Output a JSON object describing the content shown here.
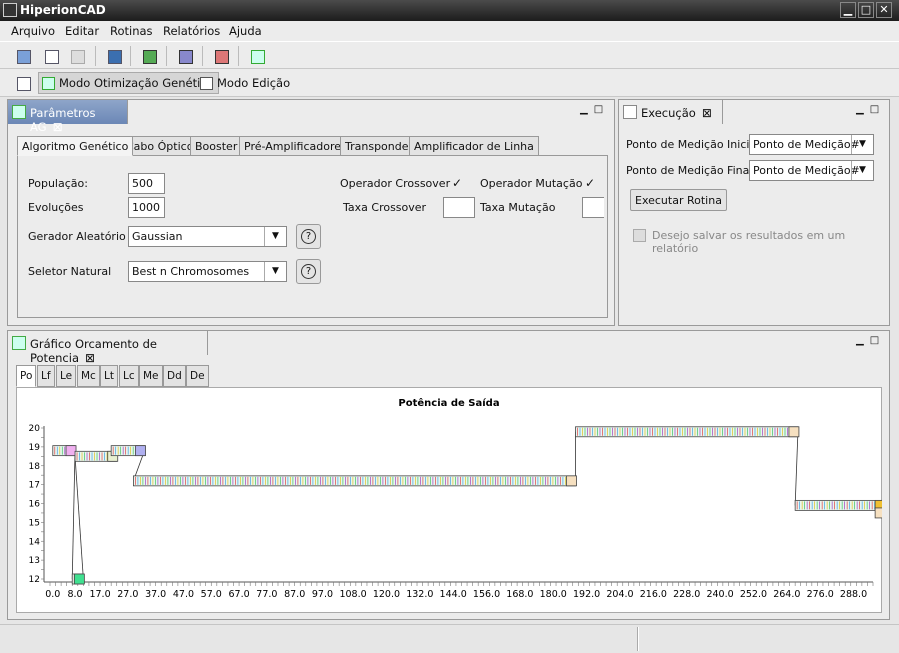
{
  "window": {
    "title": "HiperionCAD",
    "min": "▁",
    "max": "□",
    "close": "✕"
  },
  "menu": [
    "Arquivo",
    "Editar",
    "Rotinas",
    "Relatórios",
    "Ajuda"
  ],
  "perspectives": [
    "Modo Otimização Genética",
    "Modo Edição"
  ],
  "ag_view": {
    "tab_title": "Parâmetros AG",
    "tabs": [
      "Algoritmo Genético",
      "Cabo Óptico",
      "Booster",
      "Pré-Amplificadores",
      "Transponder",
      "Amplificador de Linha"
    ],
    "populacao_label": "População:",
    "populacao": "500",
    "evolucoes_label": "Evoluções",
    "evolucoes": "1000",
    "gerador_label": "Gerador Aleatório",
    "gerador": "Gaussian",
    "seletor_label": "Seletor Natural",
    "seletor": "Best n Chromosomes",
    "op_crossover_label": "Operador Crossover",
    "op_mutacao_label": "Operador Mutação",
    "taxa_crossover_label": "Taxa Crossover",
    "taxa_mutacao_label": "Taxa Mutação",
    "help": "?"
  },
  "exec_view": {
    "tab_title": "Execução",
    "inicial_label": "Ponto de Medição Inicial",
    "inicial": "Ponto de Medição#",
    "final_label": "Ponto de Medição Final",
    "final": "Ponto de Medição#",
    "run_button": "Executar Rotina",
    "save_label": "Desejo salvar os resultados em um relatório"
  },
  "graph_view": {
    "tab_title": "Gráfico Orcamento de Potencia",
    "tabs": [
      "Po",
      "Lf",
      "Le",
      "Mc",
      "Lt",
      "Lc",
      "Me",
      "Dd",
      "De"
    ]
  },
  "chart_data": {
    "type": "line",
    "title": "Potência de Saída",
    "xticks": [
      "0.0",
      "8.0",
      "17.0",
      "27.0",
      "37.0",
      "47.0",
      "57.0",
      "67.0",
      "77.0",
      "87.0",
      "97.0",
      "108.0",
      "120.0",
      "132.0",
      "144.0",
      "156.0",
      "168.0",
      "180.0",
      "192.0",
      "204.0",
      "216.0",
      "228.0",
      "240.0",
      "252.0",
      "264.0",
      "276.0",
      "288.0"
    ],
    "yticks": [
      "12",
      "13",
      "14",
      "15",
      "16",
      "17",
      "18",
      "19",
      "20"
    ],
    "xlim": [
      -1,
      295
    ],
    "ylim": [
      12,
      20
    ],
    "segments": [
      {
        "x0": 0.0,
        "x1": 8.0,
        "y": 18.8,
        "color": "#f0b0f0"
      },
      {
        "x0": 7.0,
        "x1": 11.0,
        "y": 12.0,
        "color": "#40e090"
      },
      {
        "x0": 8.0,
        "x1": 23.0,
        "y": 18.5,
        "color": "#e8f0d0"
      },
      {
        "x0": 21.0,
        "x1": 33.0,
        "y": 18.8,
        "color": "#b0b0f0"
      },
      {
        "x0": 29.0,
        "x1": 188.0,
        "y": 17.2,
        "color": "#f6e0c0"
      },
      {
        "x0": 188.0,
        "x1": 268.0,
        "y": 19.8,
        "color": "#f6e0c0"
      },
      {
        "x0": 267.0,
        "x1": 299.0,
        "y": 15.9,
        "color": "#f0c030"
      }
    ],
    "tail_point": {
      "x": 299.0,
      "y": 15.5,
      "color": "#f6e0c0"
    }
  }
}
